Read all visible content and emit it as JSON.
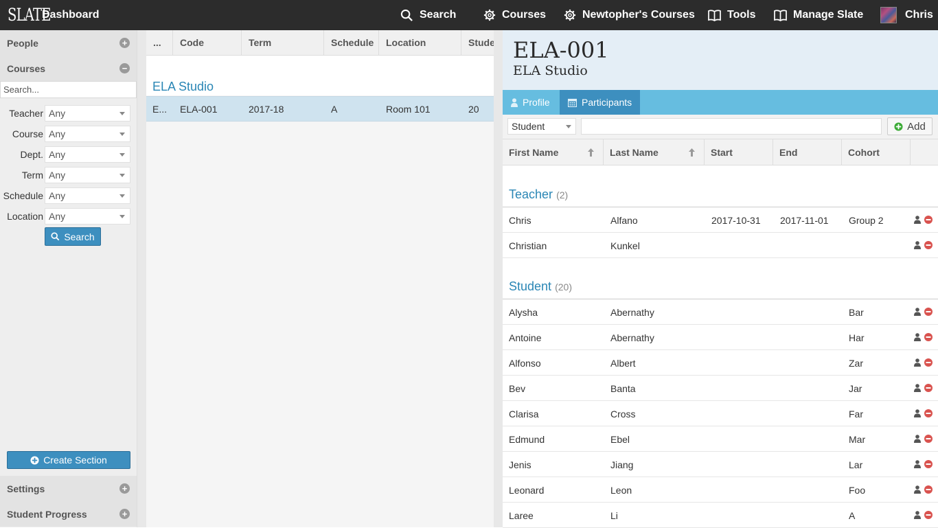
{
  "topbar": {
    "logo": "SLATE",
    "dashboard": "Dashboard",
    "search": "Search",
    "courses": "Courses",
    "my_courses": "Newtopher's Courses",
    "tools": "Tools",
    "manage": "Manage Slate",
    "user": "Chris"
  },
  "sidebar": {
    "people": "People",
    "courses": "Courses",
    "search_placeholder": "Search...",
    "filters": [
      {
        "label": "Teacher",
        "value": "Any"
      },
      {
        "label": "Course",
        "value": "Any"
      },
      {
        "label": "Dept.",
        "value": "Any"
      },
      {
        "label": "Term",
        "value": "Any"
      },
      {
        "label": "Schedule",
        "value": "Any"
      },
      {
        "label": "Location",
        "value": "Any"
      }
    ],
    "search_button": "Search",
    "create_section": "Create Section",
    "settings": "Settings",
    "student_progress": "Student Progress"
  },
  "sections": {
    "columns": [
      "...",
      "Code",
      "Term",
      "Schedule",
      "Location",
      "Stude"
    ],
    "group": "ELA Studio",
    "row": {
      "title": "E...",
      "code": "ELA-001",
      "term": "2017-18",
      "schedule": "A",
      "location": "Room 101",
      "students": "20"
    }
  },
  "detail": {
    "code": "ELA-001",
    "title": "ELA Studio",
    "tabs": {
      "profile": "Profile",
      "participants": "Participants"
    },
    "role_select": "Student",
    "add_button": "Add",
    "columns": [
      "First Name",
      "Last Name",
      "Start",
      "End",
      "Cohort"
    ],
    "teacher_group": {
      "label": "Teacher",
      "count": "(2)"
    },
    "teachers": [
      {
        "first": "Chris",
        "last": "Alfano",
        "start": "2017-10-31",
        "end": "2017-11-01",
        "cohort": "Group 2"
      },
      {
        "first": "Christian",
        "last": "Kunkel",
        "start": "",
        "end": "",
        "cohort": ""
      }
    ],
    "student_group": {
      "label": "Student",
      "count": "(20)"
    },
    "students": [
      {
        "first": "Alysha",
        "last": "Abernathy",
        "cohort": "Bar"
      },
      {
        "first": "Antoine",
        "last": "Abernathy",
        "cohort": "Har"
      },
      {
        "first": "Alfonso",
        "last": "Albert",
        "cohort": "Zar"
      },
      {
        "first": "Bev",
        "last": "Banta",
        "cohort": "Jar"
      },
      {
        "first": "Clarisa",
        "last": "Cross",
        "cohort": "Far"
      },
      {
        "first": "Edmund",
        "last": "Ebel",
        "cohort": "Mar"
      },
      {
        "first": "Jenis",
        "last": "Jiang",
        "cohort": "Lar"
      },
      {
        "first": "Leonard",
        "last": "Leon",
        "cohort": "Foo"
      },
      {
        "first": "Laree",
        "last": "Li",
        "cohort": "A"
      }
    ]
  },
  "colors": {
    "topbar": "#2c2c2c",
    "accent_blue": "#2a86b5",
    "tab_bar": "#66bde0",
    "active_tab": "#3d8fbf",
    "remove_red": "#d9534f"
  }
}
